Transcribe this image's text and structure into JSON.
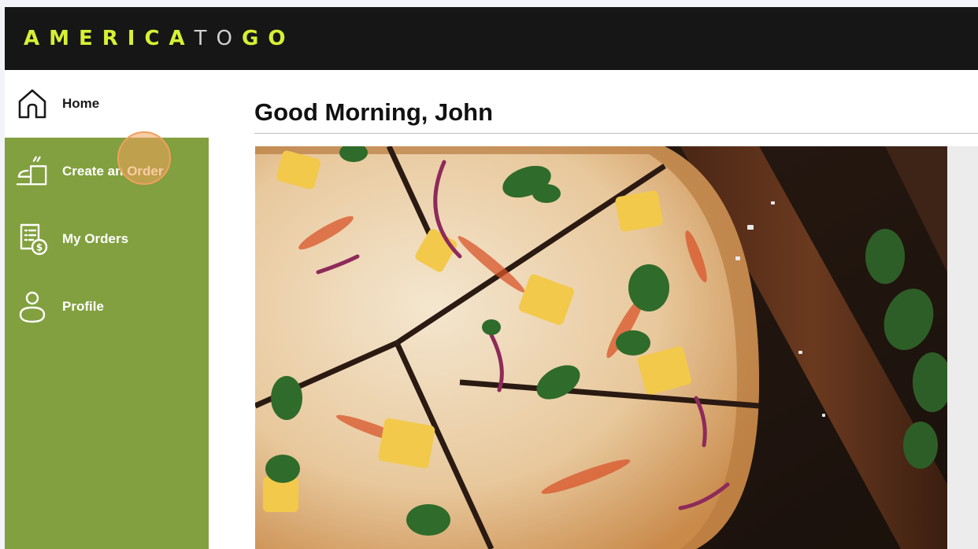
{
  "app": {
    "logo_parts": [
      "AMERICA",
      "TO",
      "GO"
    ],
    "accent_color": "#d7f034",
    "header_bg": "#161616"
  },
  "sidebar": {
    "bg_color": "#82a03f",
    "items": [
      {
        "label": "Home",
        "icon": "home-icon"
      },
      {
        "label": "Create an Order",
        "icon": "create-order-icon"
      },
      {
        "label": "My Orders",
        "icon": "orders-icon"
      },
      {
        "label": "Profile",
        "icon": "profile-icon"
      }
    ]
  },
  "main": {
    "greeting": "Good Morning, John",
    "hero_image": "pizza-on-wooden-board"
  }
}
